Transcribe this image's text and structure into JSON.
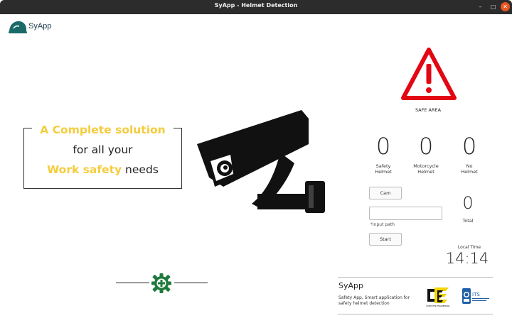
{
  "window": {
    "title": "SyApp - Helmet Detection",
    "minimize_symbol": "–",
    "maximize_symbol": "□",
    "close_symbol": "✕"
  },
  "brand": {
    "name": "SyApp",
    "color": "#1b6a6a"
  },
  "tagline": {
    "line1_highlight": "A Complete solution",
    "line2": "for all your",
    "line3_highlight": "Work safety",
    "line3_rest": " needs",
    "highlight_color": "#f5cc3d"
  },
  "status": {
    "label": "SAFE AREA",
    "icon": "warning-triangle-icon",
    "color": "#e30613"
  },
  "counters": [
    {
      "value": "0",
      "label_line1": "Safety",
      "label_line2": "Helmet"
    },
    {
      "value": "0",
      "label_line1": "Motorcycle",
      "label_line2": "Helmet"
    },
    {
      "value": "0",
      "label_line1": "No",
      "label_line2": "Helmet"
    }
  ],
  "controls": {
    "cam_label": "Cam",
    "path_value": "",
    "path_hint": "*input path",
    "start_label": "Start"
  },
  "total": {
    "value": "0",
    "label": "Total"
  },
  "clock": {
    "label": "Local Time",
    "value": "14:14"
  },
  "footer": {
    "title": "SyApp",
    "description": "Safety App, Smart application for safety helmet detection",
    "logo1_text": "COMPUTER ENGINEERING",
    "logo2_text": "ITS"
  },
  "accent_colors": {
    "gear": "#1e7a3c",
    "camera": "#111111"
  }
}
